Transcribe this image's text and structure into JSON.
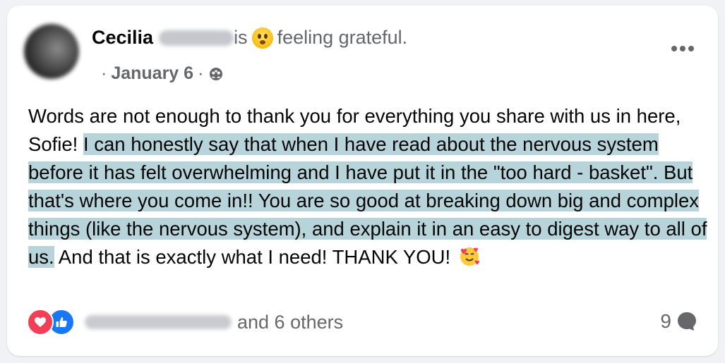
{
  "post": {
    "author_first_name": "Cecilia",
    "is_text": "is",
    "feeling_text": "feeling grateful.",
    "date_sep_before": "·",
    "date": "January 6",
    "date_sep_after": "·",
    "text_before_highlight": "Words are not enough to thank you for everything you share with us in here, Sofie! ",
    "highlighted_text": "I can honestly say that when I have read about the nervous system before it has felt overwhelming and I have put it in the \"too hard - basket\". But that's where you come in!! You are so good at breaking down big and complex things (like the nervous system), and explain it in an easy to digest way to all of us.",
    "text_after_highlight": " And that is exactly what I need! THANK YOU! ",
    "highlight_color": "#b7d4da",
    "icons": {
      "feeling": "grateful-face-emoji",
      "audience": "group-audience-icon",
      "more": "more-options-icon",
      "ending_emoji": "smiling-face-with-hearts-emoji"
    }
  },
  "reactions": {
    "types": [
      "love",
      "like"
    ],
    "others_text": "and 6 others",
    "love_color": "#f33e58",
    "like_color": "#1877f2"
  },
  "comments": {
    "count": "9",
    "icon": "comment-bubble-icon"
  }
}
